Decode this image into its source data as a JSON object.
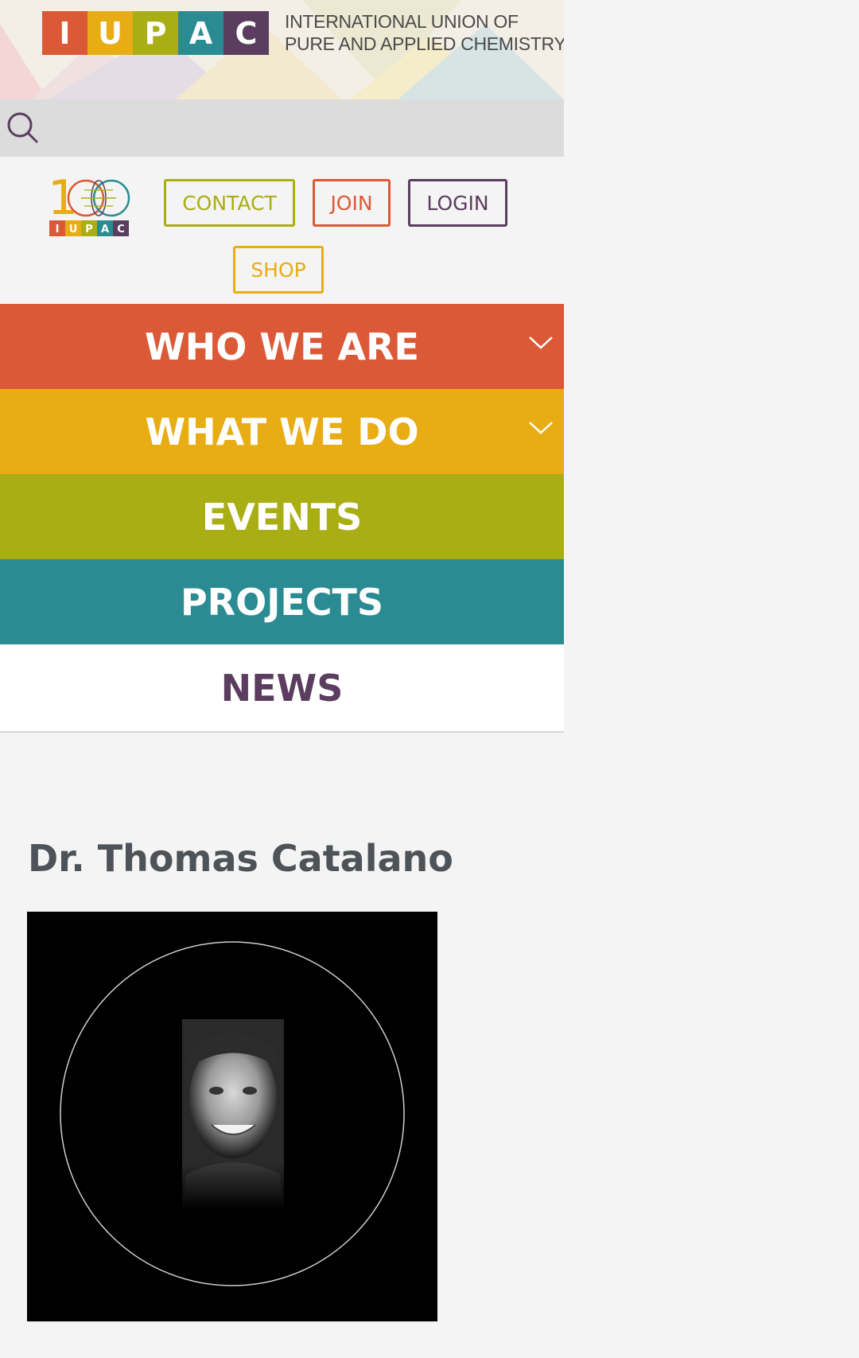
{
  "header": {
    "logo_letters": [
      "I",
      "U",
      "P",
      "A",
      "C"
    ],
    "logo_colors": [
      "#dc5937",
      "#e8ad14",
      "#a9ae14",
      "#2a8c92",
      "#5b3d5f"
    ],
    "org_name_line1": "INTERNATIONAL UNION OF",
    "org_name_line2": "PURE AND APPLIED CHEMISTRY"
  },
  "search": {
    "icon": "search-icon"
  },
  "centennial_logo": {
    "number": "100",
    "letters": [
      "I",
      "U",
      "P",
      "A",
      "C"
    ]
  },
  "buttons": {
    "contact": "CONTACT",
    "join": "JOIN",
    "login": "LOGIN",
    "shop": "SHOP"
  },
  "nav": {
    "who_we_are": "WHO WE ARE",
    "what_we_do": "WHAT WE DO",
    "events": "EVENTS",
    "projects": "PROJECTS",
    "news": "NEWS"
  },
  "profile": {
    "name": "Dr. Thomas Catalano"
  },
  "colors": {
    "red": "#dc5937",
    "yellow": "#e8ad14",
    "olive": "#a9ae14",
    "teal": "#2a8c92",
    "purple": "#5b3d5f"
  }
}
